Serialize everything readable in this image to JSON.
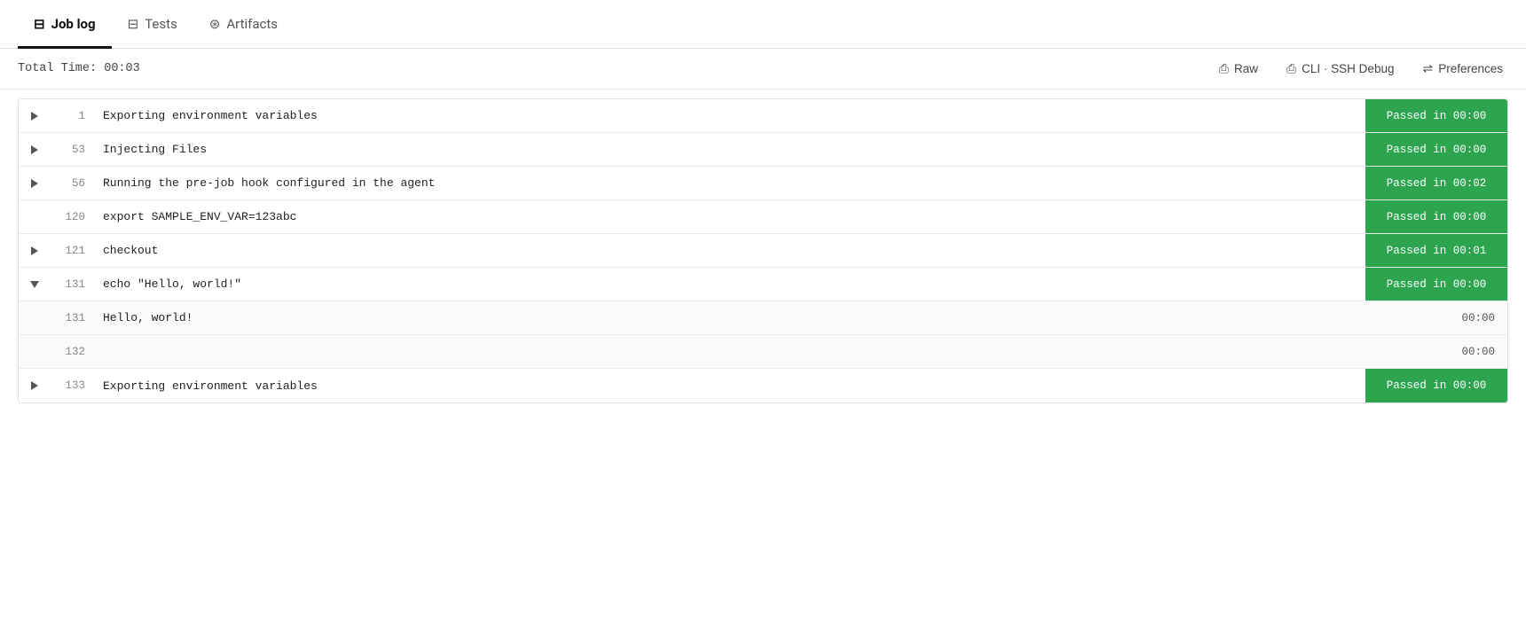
{
  "tabs": [
    {
      "id": "job-log",
      "label": "Job log",
      "icon": "📋",
      "active": true
    },
    {
      "id": "tests",
      "label": "Tests",
      "icon": "📄",
      "active": false
    },
    {
      "id": "artifacts",
      "label": "Artifacts",
      "icon": "⚙️",
      "active": false
    }
  ],
  "toolbar": {
    "total_time_label": "Total Time:",
    "total_time_value": "00:03",
    "raw_label": "Raw",
    "cli_ssh_label": "CLI · SSH Debug",
    "preferences_label": "Preferences"
  },
  "log_rows": [
    {
      "id": 1,
      "toggle": "right",
      "line": "1",
      "content": "Exporting environment variables",
      "badge": "Passed in 00:00",
      "has_badge": true
    },
    {
      "id": 2,
      "toggle": "right",
      "line": "53",
      "content": "Injecting Files",
      "badge": "Passed in 00:00",
      "has_badge": true
    },
    {
      "id": 3,
      "toggle": "right",
      "line": "56",
      "content": "Running the pre-job hook configured in the agent",
      "badge": "Passed in 00:02",
      "has_badge": true
    },
    {
      "id": 4,
      "toggle": "",
      "line": "120",
      "content": "export SAMPLE_ENV_VAR=123abc",
      "badge": "Passed in 00:00",
      "has_badge": true
    },
    {
      "id": 5,
      "toggle": "right",
      "line": "121",
      "content": "checkout",
      "badge": "Passed in 00:01",
      "has_badge": true
    },
    {
      "id": 6,
      "toggle": "down",
      "line": "131",
      "content": "echo \"Hello, world!\"",
      "badge": "Passed in 00:00",
      "has_badge": true
    },
    {
      "id": 7,
      "toggle": "",
      "line": "131",
      "content": "Hello, world!",
      "badge": "00:00",
      "has_badge": false,
      "sub": true
    },
    {
      "id": 8,
      "toggle": "",
      "line": "132",
      "content": "",
      "badge": "00:00",
      "has_badge": false,
      "sub": true
    },
    {
      "id": 9,
      "toggle": "right",
      "line": "133",
      "content": "Exporting environment variables",
      "badge": "Passed in 00:00",
      "has_badge": true
    }
  ]
}
